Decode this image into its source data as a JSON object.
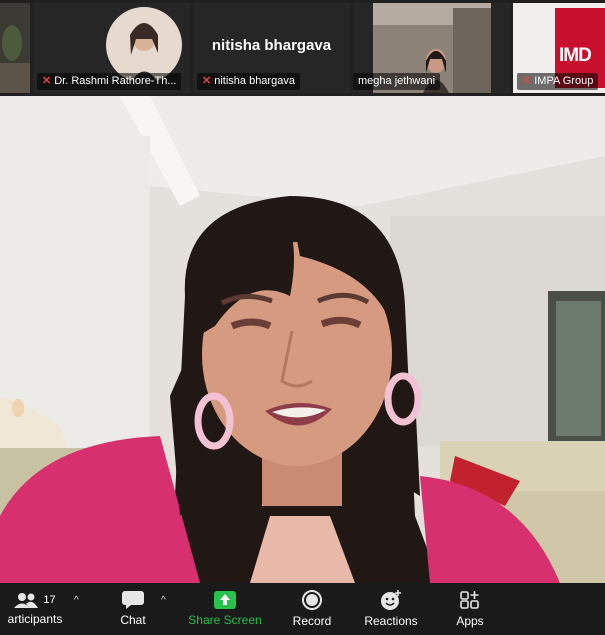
{
  "gallery": {
    "tiles": [
      {
        "name": ""
      },
      {
        "name": "Dr. Rashmi Rathore-Th..."
      },
      {
        "name": "nitisha bhargava",
        "label": "nitisha bhargava"
      },
      {
        "name": "megha jethwani"
      },
      {
        "name": "IMPA Group",
        "logo_text": "IMD"
      }
    ]
  },
  "toolbar": {
    "participants_label": "articipants",
    "participants_count": "17",
    "chat_label": "Chat",
    "share_label": "Share Screen",
    "record_label": "Record",
    "reactions_label": "Reactions",
    "apps_label": "Apps",
    "caret": "^"
  },
  "colors": {
    "share_green": "#27c14b",
    "mute_red": "#e0453a",
    "imda_red": "#c8102e"
  }
}
